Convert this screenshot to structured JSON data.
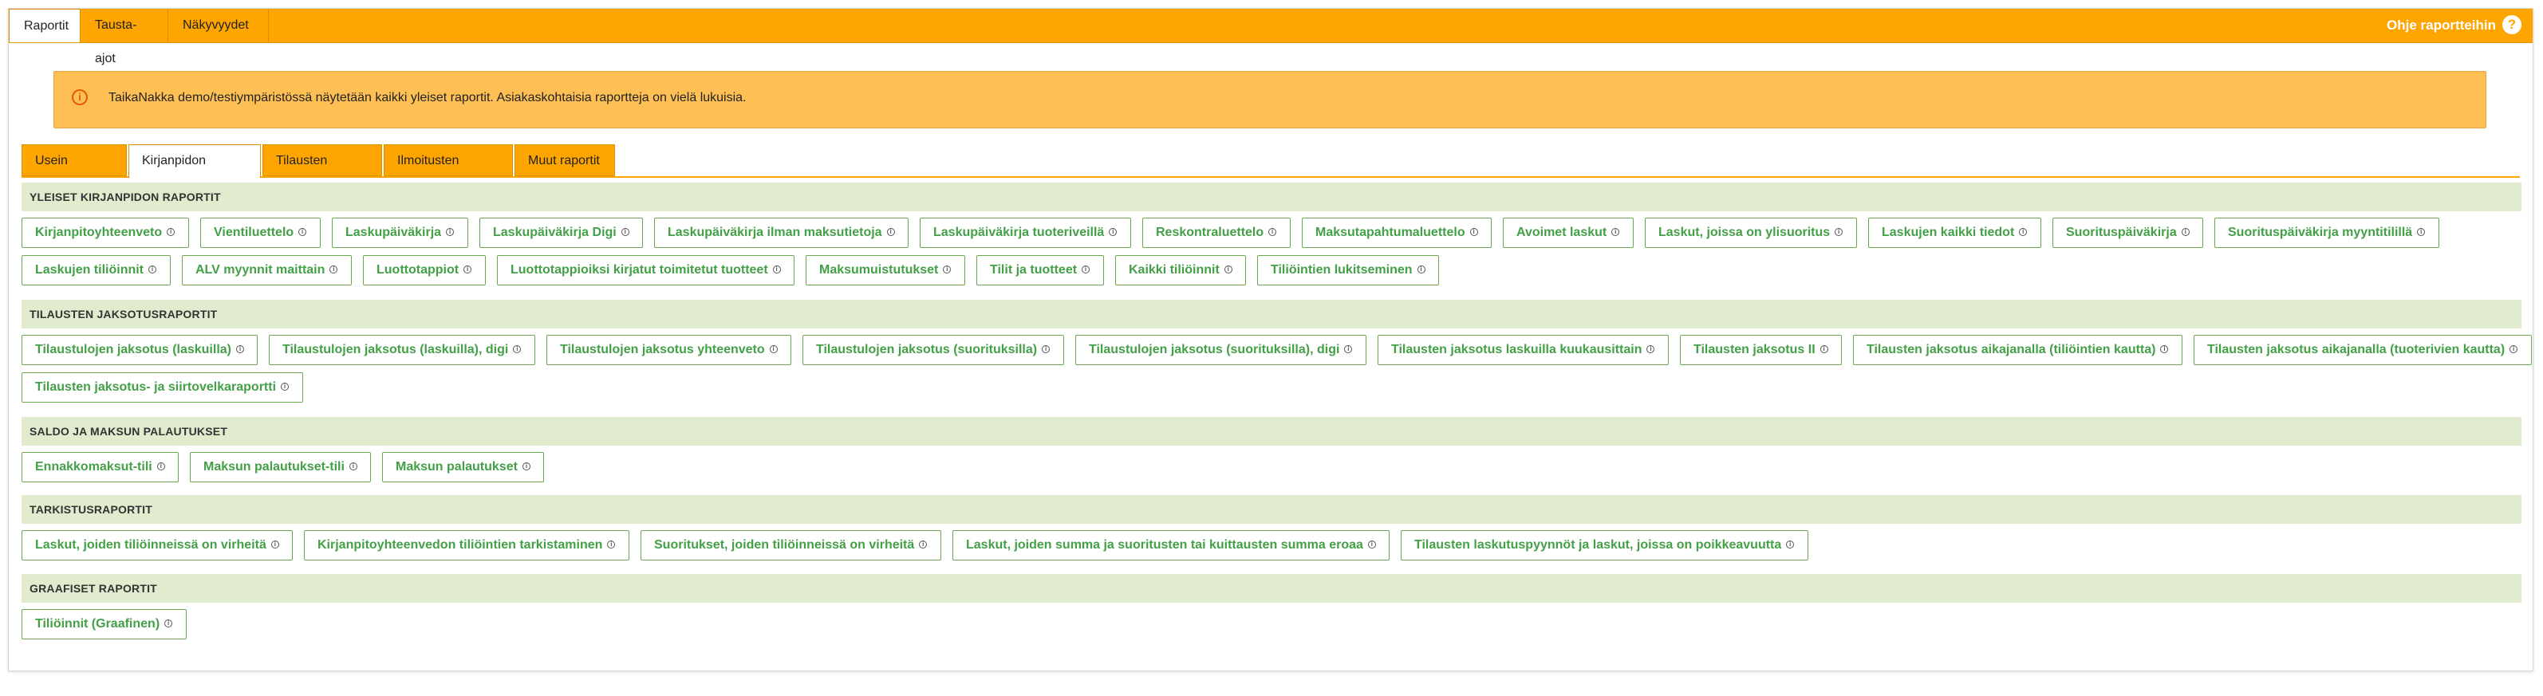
{
  "top_tabs": [
    "Raportit",
    "Tausta-ajot",
    "Näkyvyydet"
  ],
  "help_label": "Ohje raportteihin",
  "help_icon": "?",
  "notice": "TaikaNakka demo/testiympäristössä näytetään kaikki yleiset raportit. Asiakaskohtaisia raportteja on vielä lukuisia.",
  "notice_icon": "i",
  "sub_tabs": [
    "Usein käytetyt",
    "Kirjanpidon raportit",
    "Tilausten raportit",
    "Ilmoitusten raportit",
    "Muut raportit"
  ],
  "sections": [
    {
      "title": "YLEISET KIRJANPIDON RAPORTIT",
      "rows": [
        [
          "Kirjanpitoyhteenveto",
          "Vientiluettelo",
          "Laskupäiväkirja",
          "Laskupäiväkirja Digi",
          "Laskupäiväkirja ilman maksutietoja",
          "Laskupäiväkirja tuoteriveillä",
          "Reskontraluettelo",
          "Maksutapahtumaluettelo",
          "Avoimet laskut",
          "Laskut, joissa on ylisuoritus",
          "Laskujen kaikki tiedot",
          "Suorituspäiväkirja",
          "Suorituspäiväkirja myyntitilillä"
        ],
        [
          "Laskujen tiliöinnit",
          "ALV myynnit maittain",
          "Luottotappiot",
          "Luottotappioiksi kirjatut toimitetut tuotteet",
          "Maksumuistutukset",
          "Tilit ja tuotteet",
          "Kaikki tiliöinnit",
          "Tiliöintien lukitseminen"
        ]
      ]
    },
    {
      "title": "TILAUSTEN JAKSOTUSRAPORTIT",
      "rows": [
        [
          "Tilaustulojen jaksotus (laskuilla)",
          "Tilaustulojen jaksotus (laskuilla), digi",
          "Tilaustulojen jaksotus yhteenveto",
          "Tilaustulojen jaksotus (suorituksilla)",
          "Tilaustulojen jaksotus (suorituksilla), digi",
          "Tilausten jaksotus laskuilla kuukausittain",
          "Tilausten jaksotus II",
          "Tilausten jaksotus aikajanalla (tiliöintien kautta)",
          "Tilausten jaksotus aikajanalla (tuoterivien kautta)"
        ],
        [
          "Tilausten jaksotus- ja siirtovelkaraportti"
        ]
      ]
    },
    {
      "title": "SALDO JA MAKSUN PALAUTUKSET",
      "rows": [
        [
          "Ennakkomaksut-tili",
          "Maksun palautukset-tili",
          "Maksun palautukset"
        ]
      ]
    },
    {
      "title": "TARKISTUSRAPORTIT",
      "rows": [
        [
          "Laskut, joiden tiliöinneissä on virheitä",
          "Kirjanpitoyhteenvedon tiliöintien tarkistaminen",
          "Suoritukset, joiden tiliöinneissä on virheitä",
          "Laskut, joiden summa ja suoritusten tai kuittausten summa eroaa",
          "Tilausten laskutuspyynnöt ja laskut, joissa on poikkeavuutta"
        ]
      ]
    },
    {
      "title": "GRAAFISET RAPORTIT",
      "rows": [
        [
          "Tiliöinnit (Graafinen)"
        ]
      ]
    }
  ],
  "info_icon": "i",
  "colors": {
    "accent": "#ffa500",
    "notice_bg": "#fec055",
    "section_bg": "#e1ecce",
    "link_green": "#43a047"
  }
}
